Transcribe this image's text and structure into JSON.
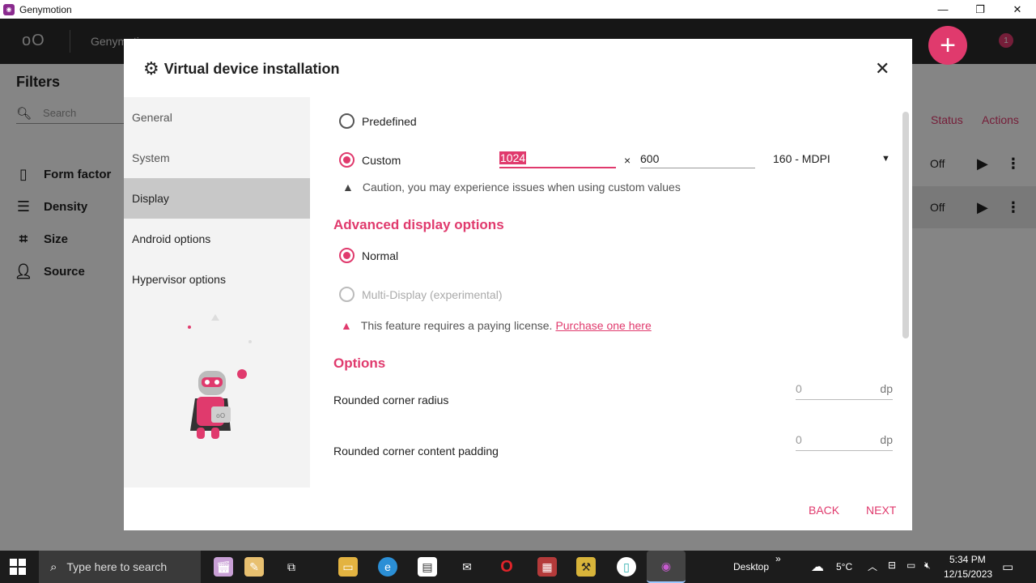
{
  "window": {
    "title": "Genymotion",
    "app_icon": "genymotion-logo-icon"
  },
  "app": {
    "logo": "oO",
    "header_tab": "Genymotion ...",
    "notification_count": "1",
    "filters": {
      "title": "Filters",
      "search_placeholder": "Search",
      "items": [
        {
          "label": "Form factor",
          "icon": "phone-icon"
        },
        {
          "label": "Density",
          "icon": "sliders-icon"
        },
        {
          "label": "Size",
          "icon": "crop-icon"
        },
        {
          "label": "Source",
          "icon": "person-icon"
        }
      ]
    },
    "columns": {
      "status": "Status",
      "actions": "Actions"
    },
    "devices": [
      {
        "status": "Off"
      },
      {
        "status": "Off"
      }
    ]
  },
  "dialog": {
    "title": "Virtual device installation",
    "nav": [
      {
        "label": "General"
      },
      {
        "label": "System"
      },
      {
        "label": "Display"
      },
      {
        "label": "Android options"
      },
      {
        "label": "Hypervisor options"
      }
    ],
    "display": {
      "predefined_label": "Predefined",
      "custom_label": "Custom",
      "width_value": "1024",
      "height_value": "600",
      "times_symbol": "×",
      "density_value": "160 - MDPI",
      "caution_text": "Caution, you may experience issues when using custom values"
    },
    "advanced": {
      "title": "Advanced display options",
      "normal_label": "Normal",
      "multi_label": "Multi-Display (experimental)",
      "license_text": "This feature requires a paying license.",
      "license_link": "Purchase one here"
    },
    "options": {
      "title": "Options",
      "corner_radius_label": "Rounded corner radius",
      "corner_radius_value": "0",
      "corner_padding_label": "Rounded corner content padding",
      "corner_padding_value": "0",
      "unit": "dp"
    },
    "buttons": {
      "back": "BACK",
      "next": "NEXT"
    }
  },
  "taskbar": {
    "search_placeholder": "Type here to search",
    "desktop_label": "Desktop",
    "chevron": "»",
    "weather": "5°C",
    "time": "5:34 PM",
    "date": "12/15/2023"
  },
  "colors": {
    "accent": "#e03a6d",
    "header": "#2b2b2b",
    "taskbar": "#1c1c1c"
  }
}
